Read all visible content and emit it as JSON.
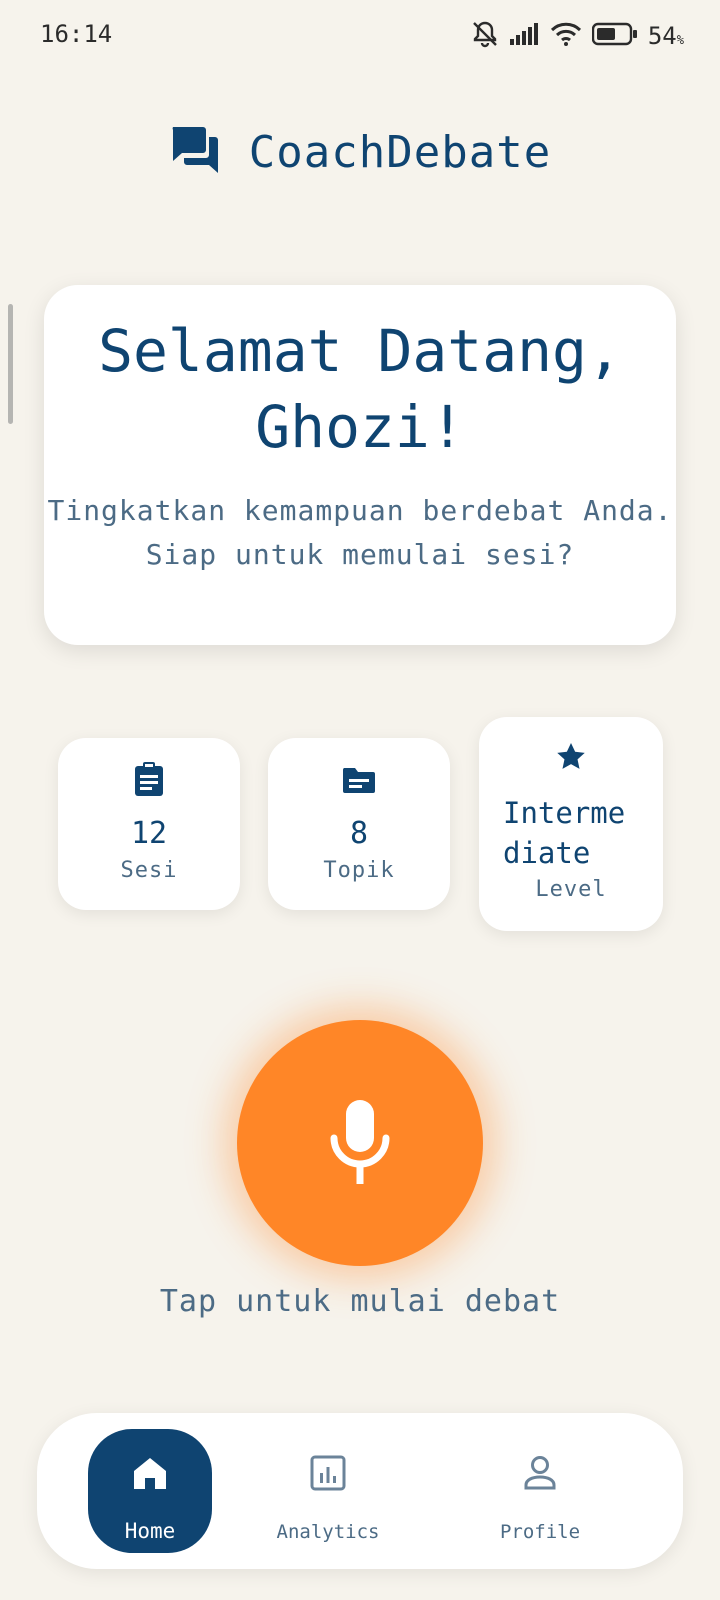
{
  "status_bar": {
    "time": "16:14",
    "battery_percent": "54",
    "battery_suffix": "%",
    "icons": [
      "mute-icon",
      "signal-icon",
      "wifi-icon",
      "battery-icon"
    ]
  },
  "header": {
    "title": "CoachDebate",
    "icon": "chat-bubbles-icon"
  },
  "welcome": {
    "title": "Selamat Datang, Ghozi!",
    "subtitle": "Tingkatkan kemampuan berdebat Anda.\nSiap untuk memulai sesi?"
  },
  "stats": [
    {
      "icon": "clipboard-icon",
      "value": "12",
      "label": "Sesi"
    },
    {
      "icon": "folder-icon",
      "value": "8",
      "label": "Topik"
    },
    {
      "icon": "star-icon",
      "value": "Interme\ndiate",
      "label": "Level"
    }
  ],
  "mic": {
    "icon": "microphone-icon",
    "caption": "Tap untuk mulai debat"
  },
  "nav": {
    "items": [
      {
        "label": "Home",
        "icon": "home-icon",
        "active": true
      },
      {
        "label": "Analytics",
        "icon": "analytics-icon",
        "active": false
      },
      {
        "label": "Profile",
        "icon": "profile-icon",
        "active": false
      }
    ]
  },
  "colors": {
    "background": "#f6f3ec",
    "primary": "#0f4471",
    "accent": "#ff8627",
    "muted_text": "#4c6b85"
  }
}
